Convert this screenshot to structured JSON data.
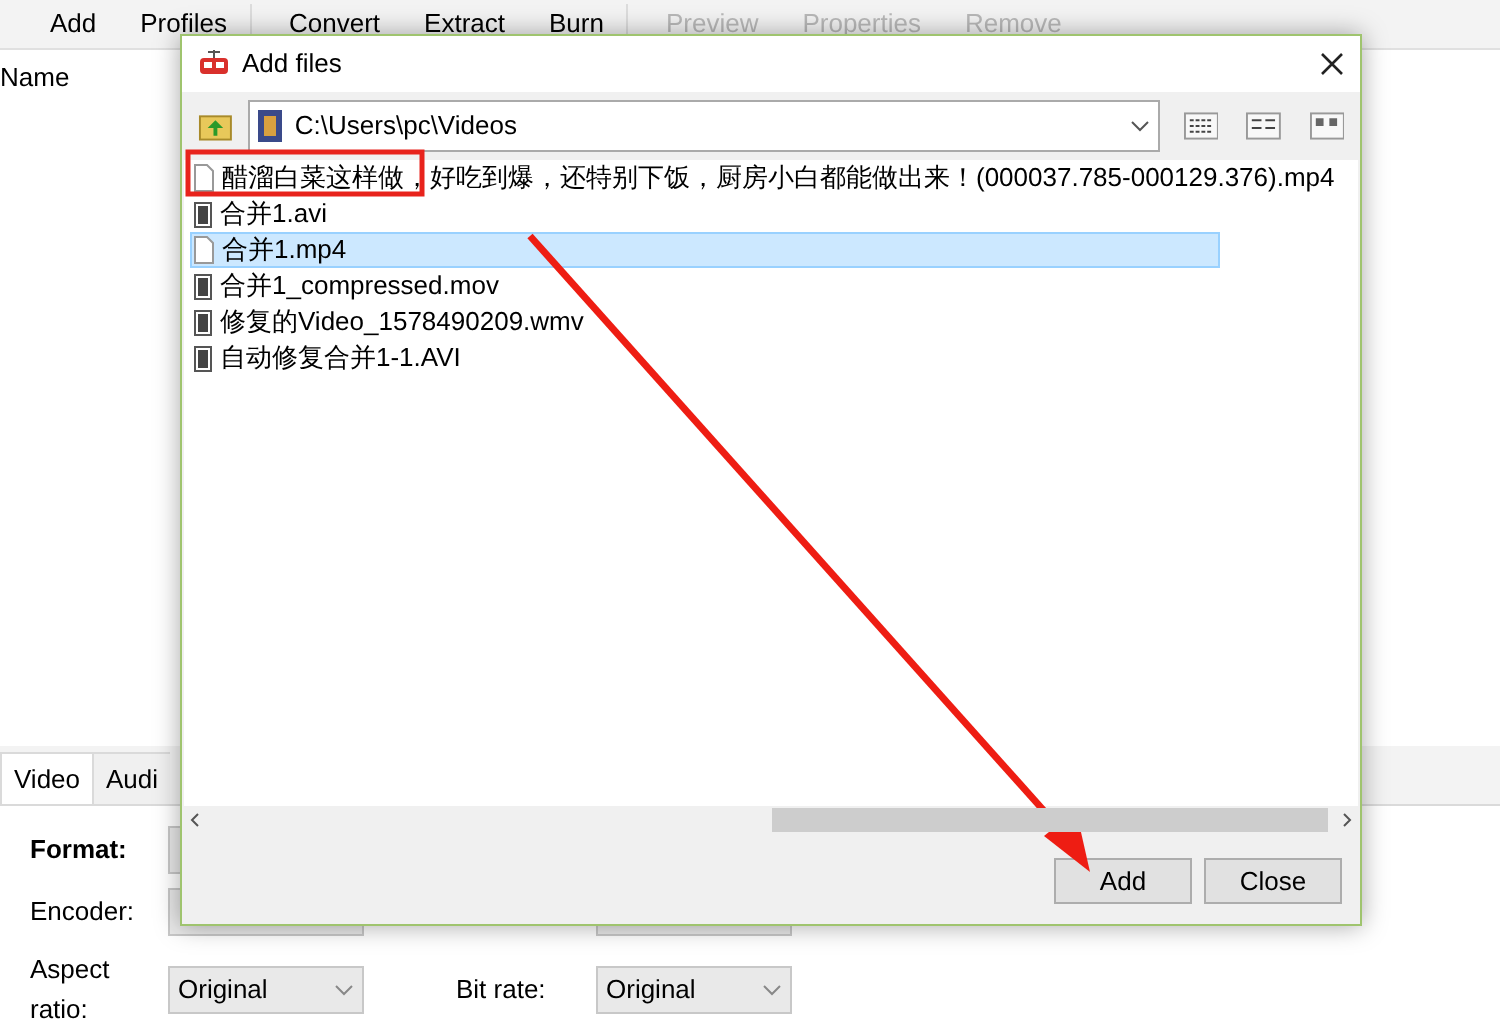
{
  "toolbar": [
    {
      "label": "Add",
      "disabled": false
    },
    {
      "label": "Profiles",
      "disabled": false
    },
    {
      "label": "Convert",
      "disabled": false
    },
    {
      "label": "Extract",
      "disabled": false
    },
    {
      "label": "Burn",
      "disabled": false
    },
    {
      "label": "Preview",
      "disabled": true
    },
    {
      "label": "Properties",
      "disabled": true
    },
    {
      "label": "Remove",
      "disabled": true
    }
  ],
  "file_list": {
    "columns": [
      "Name"
    ]
  },
  "settings": {
    "tabs": [
      {
        "label": "Video",
        "selected": true
      },
      {
        "label": "Audi",
        "selected": false
      }
    ],
    "fields": [
      {
        "label": "Format:",
        "bold": true
      },
      {
        "label": "Encoder:",
        "bold": false
      },
      {
        "label": "Aspect ratio:",
        "bold": false,
        "value": "Original"
      },
      {
        "label": "Bit rate:",
        "bold": false,
        "value": "Original"
      }
    ]
  },
  "dialog": {
    "title": "Add files",
    "path": "C:\\Users\\pc\\Videos",
    "files": [
      {
        "name": "醋溜白菜这样做，好吃到爆，还特别下饭，厨房小白都能做出来！(000037.785-000129.376).mp4",
        "kind": "plain",
        "selected": false
      },
      {
        "name": "合并1.avi",
        "kind": "video",
        "selected": false
      },
      {
        "name": "合并1.mp4",
        "kind": "plain",
        "selected": true
      },
      {
        "name": "合并1_compressed.mov",
        "kind": "video",
        "selected": false
      },
      {
        "name": "修复的Video_1578490209.wmv",
        "kind": "video",
        "selected": false
      },
      {
        "name": "自动修复合并1-1.AVI",
        "kind": "video",
        "selected": false
      }
    ],
    "buttons": [
      "Add",
      "Close"
    ]
  }
}
